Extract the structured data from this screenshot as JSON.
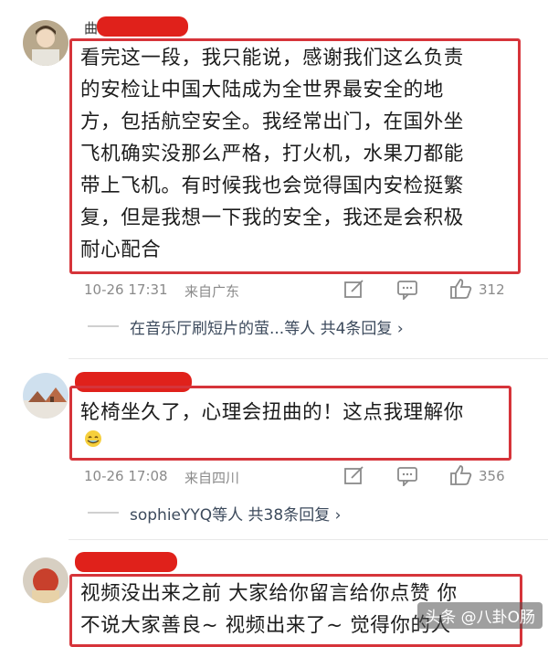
{
  "comments": [
    {
      "username_visible": "曲",
      "text_lines": [
        "看完这一段，我只能说，感谢我们这么负责",
        "的安检让中国大陆成为全世界最安全的地",
        "方，包括航空安全。我经常出门，在国外坐",
        "飞机确实没那么严格，打火机，水果刀都能",
        "带上飞机。有时候我也会觉得国内安检挺繁",
        "复，但是我想一下我的安全，我还是会积极",
        "耐心配合"
      ],
      "time": "10-26 17:31",
      "location": "来自广东",
      "likes": "312",
      "replies": "在音乐厅刷短片的萤...等人  共4条回复 ›"
    },
    {
      "text_lines": [
        "轮椅坐久了，心理会扭曲的！这点我理解你"
      ],
      "time": "10-26 17:08",
      "location": "来自四川",
      "likes": "356",
      "replies": "sophieYYQ等人  共38条回复 ›"
    },
    {
      "text_lines": [
        "视频没出来之前 大家给你留言给你点赞 你",
        "不说大家善良~ 视频出来了~ 觉得你的人"
      ]
    }
  ],
  "watermark": "头条 @八卦O肠",
  "colors": {
    "redbox": "#d6343a",
    "redact": "#e0211b",
    "meta": "#8a8a8a"
  }
}
